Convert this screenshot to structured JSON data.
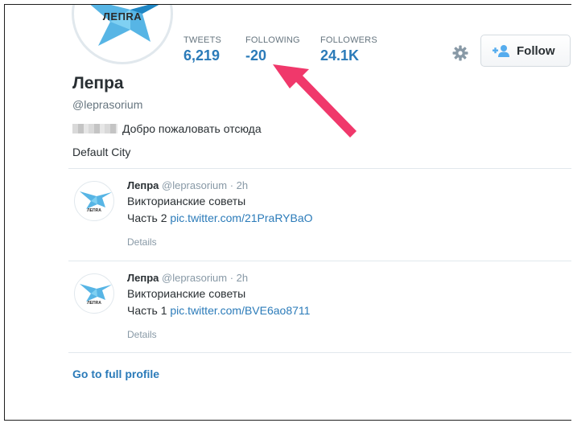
{
  "profile": {
    "avatar_logo": "ЛЕПRA",
    "display_name": "Лепра",
    "screen_name": "@leprasorium",
    "bio": "Добро пожаловать отсюда",
    "location": "Default City"
  },
  "stats": [
    {
      "label": "TWEETS",
      "value": "6,219"
    },
    {
      "label": "FOLLOWING",
      "value": "-20"
    },
    {
      "label": "FOLLOWERS",
      "value": "24.1K"
    }
  ],
  "actions": {
    "settings_icon": "gear-icon",
    "follow_label": "Follow",
    "follow_icon": "add-user-icon"
  },
  "tweets": [
    {
      "name": "Лепра",
      "meta": "@leprasorium · 2h",
      "line1": "Викторианские советы",
      "line2_text": "Часть 2 ",
      "link": "pic.twitter.com/21PraRYBaO",
      "details": "Details",
      "avatar_text": "ЛЕПRA"
    },
    {
      "name": "Лепра",
      "meta": "@leprasorium · 2h",
      "line1": "Викторианские советы",
      "line2_text": "Часть 1 ",
      "link": "pic.twitter.com/BVE6ao8711",
      "details": "Details",
      "avatar_text": "ЛЕПRA"
    }
  ],
  "footer": {
    "full_profile": "Go to full profile"
  },
  "colors": {
    "link": "#2b7bb9",
    "annotation_arrow": "#f0386b",
    "logo_blue": "#3aa8e0"
  }
}
